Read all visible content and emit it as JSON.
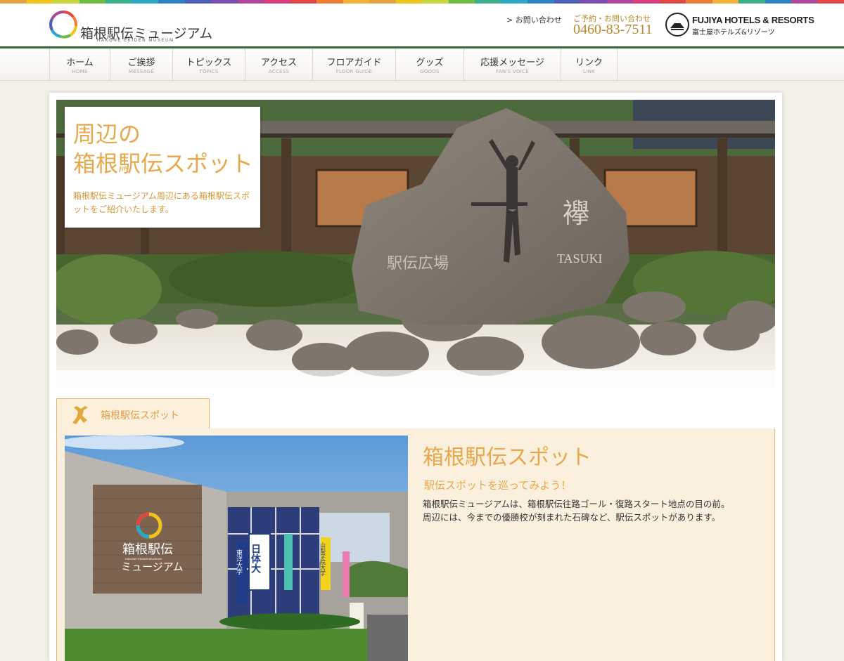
{
  "rainbow_colors": [
    "#e6a23c",
    "#f0c419",
    "#c7d63c",
    "#6dbd45",
    "#3bb08f",
    "#2aa8c8",
    "#2d7fc7",
    "#4d5fb5",
    "#7a4fb0",
    "#b0469c",
    "#d93f7a",
    "#e04848",
    "#ef7d32",
    "#f2b134",
    "#e6a23c",
    "#f0c419",
    "#c7d63c",
    "#6dbd45",
    "#3bb08f",
    "#2aa8c8",
    "#2d7fc7",
    "#4d5fb5",
    "#7a4fb0",
    "#b0469c",
    "#d93f7a",
    "#e04848",
    "#ef7d32",
    "#f2b134",
    "#3bb08f",
    "#2d7fc7",
    "#b0469c",
    "#e04848"
  ],
  "header": {
    "logo_jp": "箱根駅伝ミュージアム",
    "logo_en": "HAKONE EKIDEN MUSEUM",
    "contact_link": "> お問い合わせ",
    "tel_label": "ご予約・お問い合わせ",
    "tel_number": "0460-83-7511",
    "partner_en": "FUJIYA HOTELS & RESORTS",
    "partner_jp": "富士屋ホテルズ&リゾーツ"
  },
  "nav": [
    {
      "jp": "ホーム",
      "en": "HOME"
    },
    {
      "jp": "ご挨拶",
      "en": "MESSAGE"
    },
    {
      "jp": "トピックス",
      "en": "TOPICS"
    },
    {
      "jp": "アクセス",
      "en": "ACCESS"
    },
    {
      "jp": "フロアガイド",
      "en": "FLOOR GUIDE"
    },
    {
      "jp": "グッズ",
      "en": "GOODS"
    },
    {
      "jp": "応援メッセージ",
      "en": "FAN'S VOICE"
    },
    {
      "jp": "リンク",
      "en": "LINK"
    }
  ],
  "hero": {
    "title": "周辺の\n箱根駅伝スポット",
    "description": "箱根駅伝ミュージアム周辺にある箱根駅伝スポットをご紹介いたします。",
    "monument_text_1": "駅伝広場",
    "monument_text_2": "襷",
    "monument_text_3": "TASUKI"
  },
  "tab": {
    "label": "箱根駅伝スポット"
  },
  "spot": {
    "title": "箱根駅伝スポット",
    "subtitle": "駅伝スポットを巡ってみよう！",
    "body_1": "箱根駅伝ミュージアムは、箱根駅伝往路ゴール・復路スタート地点の目の前。",
    "body_2": "周辺には、今までの優勝校が刻まれた石碑など、駅伝スポットがあります。"
  },
  "photo": {
    "sign_line1": "箱根駅伝",
    "sign_line2": "ミュージアム",
    "sign_en": "HAKONE EKIDEN MUSEUM",
    "banners": [
      "東洋大学",
      "日体大",
      "山梨学院大学"
    ]
  }
}
